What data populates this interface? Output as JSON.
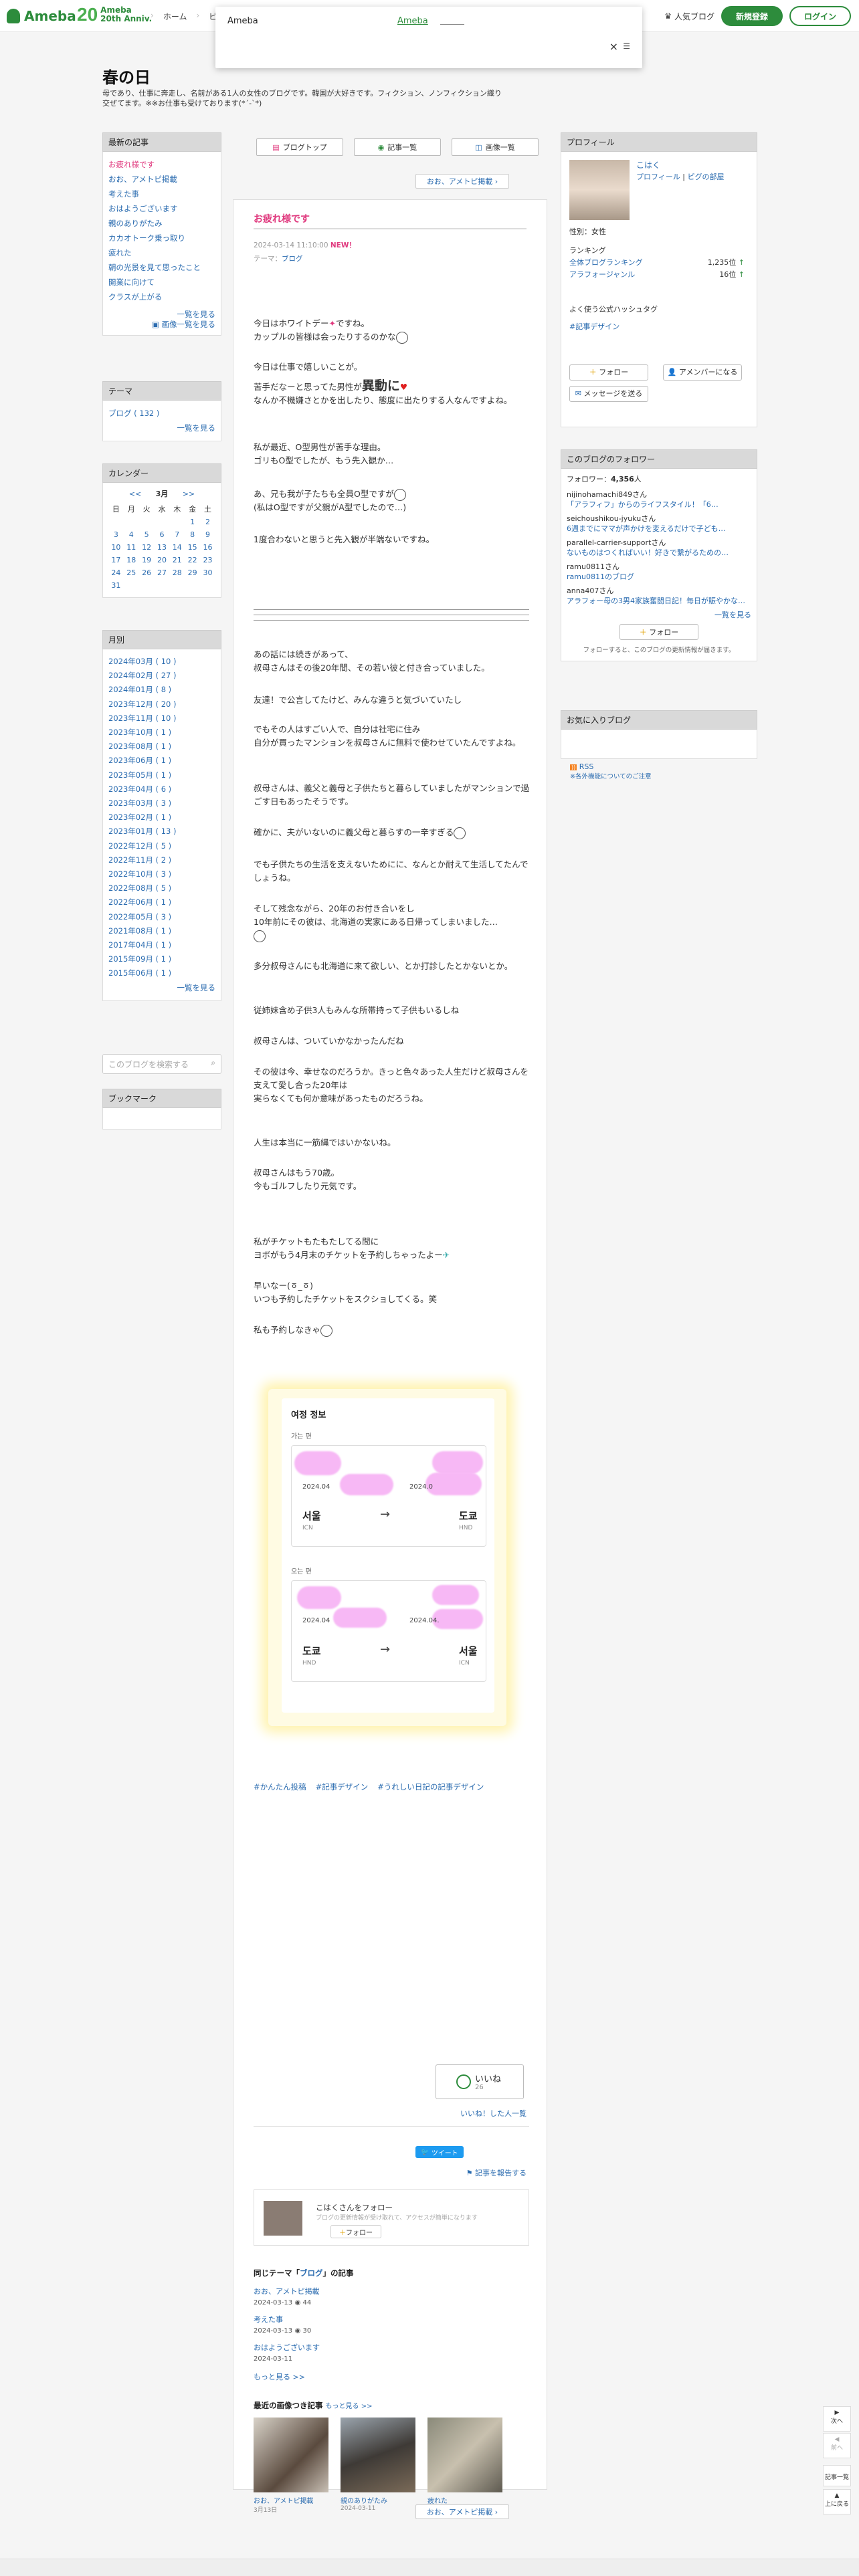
{
  "header": {
    "logo": "Ameba",
    "anniv_num": "20",
    "anniv_line1": "Ameba",
    "anniv_line2": "20th Anniv.",
    "nav": [
      "ホーム",
      "ピ"
    ],
    "popular_blog": "人気ブログ",
    "register": "新規登録",
    "login": "ログイン"
  },
  "popup": {
    "title": "Ameba",
    "link": "Ameba"
  },
  "blog": {
    "title": "春の日",
    "description": "母であり、仕事に奔走し、名前がある1人の女性のブログです。韓国が大好きです。フィクション、ノンフィクション織り交ぜてます。※※お仕事も受けております(*´-`*)"
  },
  "sidebar_left": {
    "recent_title": "最新の記事",
    "recent": [
      "お疲れ様です",
      "おお、アメトピ掲載",
      "考えた事",
      "おはようございます",
      "親のありがたみ",
      "カカオトーク乗っ取り",
      "疲れた",
      "朝の光景を見て思ったこと",
      "開業に向けて",
      "クラスが上がる"
    ],
    "recent_more": "一覧を見る",
    "image_more": "画像一覧を見る",
    "theme_title": "テーマ",
    "theme_item": "ブログ ( 132 )",
    "theme_more": "一覧を見る",
    "calendar_title": "カレンダー",
    "cal_prev": "<<",
    "cal_month": "3月",
    "cal_next": ">>",
    "cal_days": [
      "日",
      "月",
      "火",
      "水",
      "木",
      "金",
      "土"
    ],
    "cal_rows": [
      [
        "",
        "",
        "",
        "",
        "",
        "1",
        "2"
      ],
      [
        "3",
        "4",
        "5",
        "6",
        "7",
        "8",
        "9"
      ],
      [
        "10",
        "11",
        "12",
        "13",
        "14",
        "15",
        "16"
      ],
      [
        "17",
        "18",
        "19",
        "20",
        "21",
        "22",
        "23"
      ],
      [
        "24",
        "25",
        "26",
        "27",
        "28",
        "29",
        "30"
      ],
      [
        "31",
        "",
        "",
        "",
        "",
        "",
        ""
      ]
    ],
    "monthly_title": "月別",
    "monthly": [
      "2024年03月 ( 10 )",
      "2024年02月 ( 27 )",
      "2024年01月 ( 8 )",
      "2023年12月 ( 20 )",
      "2023年11月 ( 10 )",
      "2023年10月 ( 1 )",
      "2023年08月 ( 1 )",
      "2023年06月 ( 1 )",
      "2023年05月 ( 1 )",
      "2023年04月 ( 6 )",
      "2023年03月 ( 3 )",
      "2023年02月 ( 1 )",
      "2023年01月 ( 13 )",
      "2022年12月 ( 5 )",
      "2022年11月 ( 2 )",
      "2022年10月 ( 3 )",
      "2022年08月 ( 5 )",
      "2022年06月 ( 1 )",
      "2022年05月 ( 3 )",
      "2021年08月 ( 1 )",
      "2017年04月 ( 1 )",
      "2015年09月 ( 1 )",
      "2015年06月 ( 1 )"
    ],
    "monthly_more": "一覧を見る",
    "search_placeholder": "このブログを検索する",
    "bookmark_title": "ブックマーク"
  },
  "main": {
    "tab_top": "ブログトップ",
    "tab_list": "記事一覧",
    "tab_images": "画像一覧",
    "next_link": "おお、アメトピ掲載",
    "title": "お疲れ様です",
    "date": "2024-03-14 11:10:00",
    "new_badge": "NEW！",
    "theme_label": "テーマ：",
    "theme_link": "ブログ",
    "paragraphs": {
      "p1a": "今日はホワイトデー",
      "p1b": "ですね。",
      "p1c": "カップルの皆様は会ったりするのかな",
      "p2": "今日は仕事で嬉しいことが。",
      "p3a": "苦手だなーと思ってた男性が",
      "p3big": "異動に",
      "p3b": "なんか不機嫌さとかを出したり、態度に出たりする人なんですよね。",
      "p4a": "私が最近、O型男性が苦手な理由。",
      "p4b": "ゴリもO型でしたが、もう先入観か…",
      "p5a": "あ、兄も我が子たちも全員O型ですが",
      "p5b": "(私はO型ですが父親がA型でしたので…)",
      "p6": "1度合わないと思うと先入観が半端ないですね。",
      "p7a": "あの話には続きがあって、",
      "p7b": "叔母さんはその後20年間、その若い彼と付き合っていました。",
      "p8": "友達！で公言してたけど、みんな違うと気づいていたし",
      "p9a": "でもその人はすごい人で、自分は社宅に住み",
      "p9b": "自分が買ったマンションを叔母さんに無料で使わせていたんですよね。",
      "p10a": "叔母さんは、義父と義母と子供たちと暮らしていましたがマンションで過ごす日もあったそうです。",
      "p11": "確かに、夫がいないのに義父母と暮らすの一辛すぎる",
      "p12a": "でも子供たちの生活を支えないためにに、なんとか耐えて生活してたんでしょうね。",
      "p13a": "そして残念ながら、20年のお付き合いをし",
      "p13b": "10年前にその彼は、北海道の実家にある日帰ってしまいました…",
      "p14": "多分叔母さんにも北海道に来て欲しい、とか打診したとかないとか。",
      "p15": "従姉妹含め子供3人もみんな所帯持って子供もいるしね",
      "p16": "叔母さんは、ついていかなかったんだね",
      "p17a": "その彼は今、幸せなのだろうか。きっと色々あった人生だけど叔母さんを支えて愛し合った20年は",
      "p17b": "実らなくても何か意味があったものだろうね。",
      "p18": "人生は本当に一筋縄ではいかないね。",
      "p19a": "叔母さんはもう70歳。",
      "p19b": "今もゴルフしたり元気です。",
      "p20a": "私がチケットもたもたしてる間に",
      "p20b": "ヨボがもう4月末のチケットを予約しちゃったよー",
      "p21a": "早いなー(ㆆ_ㆆ)",
      "p21b": "いつも予約したチケットをスクショしてくる。笑",
      "p22": "私も予約しなきゃ"
    },
    "ticket": {
      "head": "여정 정보",
      "outbound_label": "가는 편",
      "return_label": "오는 편",
      "out_date_left": "2024.04",
      "out_date_right": "2024.0",
      "out_from_city": "서울",
      "out_from_code": "ICN",
      "out_to_city": "도쿄",
      "out_to_code": "HND",
      "ret_date_left": "2024.04",
      "ret_date_right": "2024.04.",
      "ret_from_city": "도쿄",
      "ret_from_code": "HND",
      "ret_to_city": "서울",
      "ret_to_code": "ICN"
    },
    "tags": [
      "#かんたん投稿",
      "#記事デザイン",
      "#うれしい日記の記事デザイン"
    ],
    "iine_label": "いいね",
    "iine_count": "26",
    "iine_users": "いいね！した人一覧",
    "tweet": "ツイート",
    "report": "記事を報告する",
    "follow_name": "こはくさんをフォロー",
    "follow_note": "ブログの更新情報が受け取れて、アクセスが簡単になります",
    "follow_btn": "フォロー",
    "related_title_pre": "同じテーマ「",
    "related_title_theme": "ブログ",
    "related_title_post": "」の記事",
    "related": [
      {
        "title": "おお、アメトピ掲載",
        "date": "2024-03-13",
        "count": "44"
      },
      {
        "title": "考えた事",
        "date": "2024-03-13",
        "count": "30"
      },
      {
        "title": "おはようございます",
        "date": "2024-03-11",
        "count": ""
      }
    ],
    "related_more": "もっと見る >>",
    "images_title": "最近の画像つき記事",
    "images_more": "もっと見る >>",
    "images": [
      {
        "caption": "おお、アメトピ掲載",
        "date": "3月13日"
      },
      {
        "caption": "親のありがたみ",
        "date": "2024-03-11"
      },
      {
        "caption": "疲れた",
        "date": "2024-03-09"
      }
    ]
  },
  "sidebar_right": {
    "profile_title": "プロフィール",
    "name": "こはく",
    "profile_link": "プロフィール",
    "pigg_link": "ピグの部屋",
    "gender": "性別：女性",
    "ranking_title": "ランキング",
    "rank_all_label": "全体ブログランキング",
    "rank_all_value": "1,235位",
    "rank_genre_label": "アラフォージャンル",
    "rank_genre_value": "16位",
    "hashtag_title": "よく使う公式ハッシュタグ",
    "hashtag": "#記事デザイン",
    "follow_btn": "フォロー",
    "amember_btn": "アメンバーになる",
    "message_btn": "メッセージを送る",
    "followers_title": "このブログのフォロワー",
    "followers_count": "4,356",
    "followers_unit": "人",
    "followers": [
      {
        "name": "nijinohamachi849さん",
        "blog": "「アラフィフ」からのライフスタイル！「6…"
      },
      {
        "name": "seichoushikou-jyukuさん",
        "blog": "6週までにママが声かけを変えるだけで子ども…"
      },
      {
        "name": "parallel-carrier-supportさん",
        "blog": "ないものはつくればいい！好きで繋がるための…"
      },
      {
        "name": "ramu0811さん",
        "blog": "ramu0811のブログ"
      },
      {
        "name": "anna407さん",
        "blog": "アラフォー母の3男4家族奮闘日記！毎日が賑やかな…"
      }
    ],
    "followers_more": "一覧を見る",
    "follow_btn2": "フォロー",
    "follow_note": "フォローすると、このブログの更新情報が届きます。",
    "favorite_title": "お気に入りブログ",
    "rss": "RSS",
    "rss_note": "※各外機能についてのご注意"
  },
  "floatnav": {
    "next": "次へ",
    "prev": "前へ",
    "list": "記事一覧",
    "top": "上に戻る"
  },
  "colors": {
    "accent_green": "#2d8c3c",
    "title_pink": "#e0397e",
    "link_blue": "#2b6cb0"
  }
}
